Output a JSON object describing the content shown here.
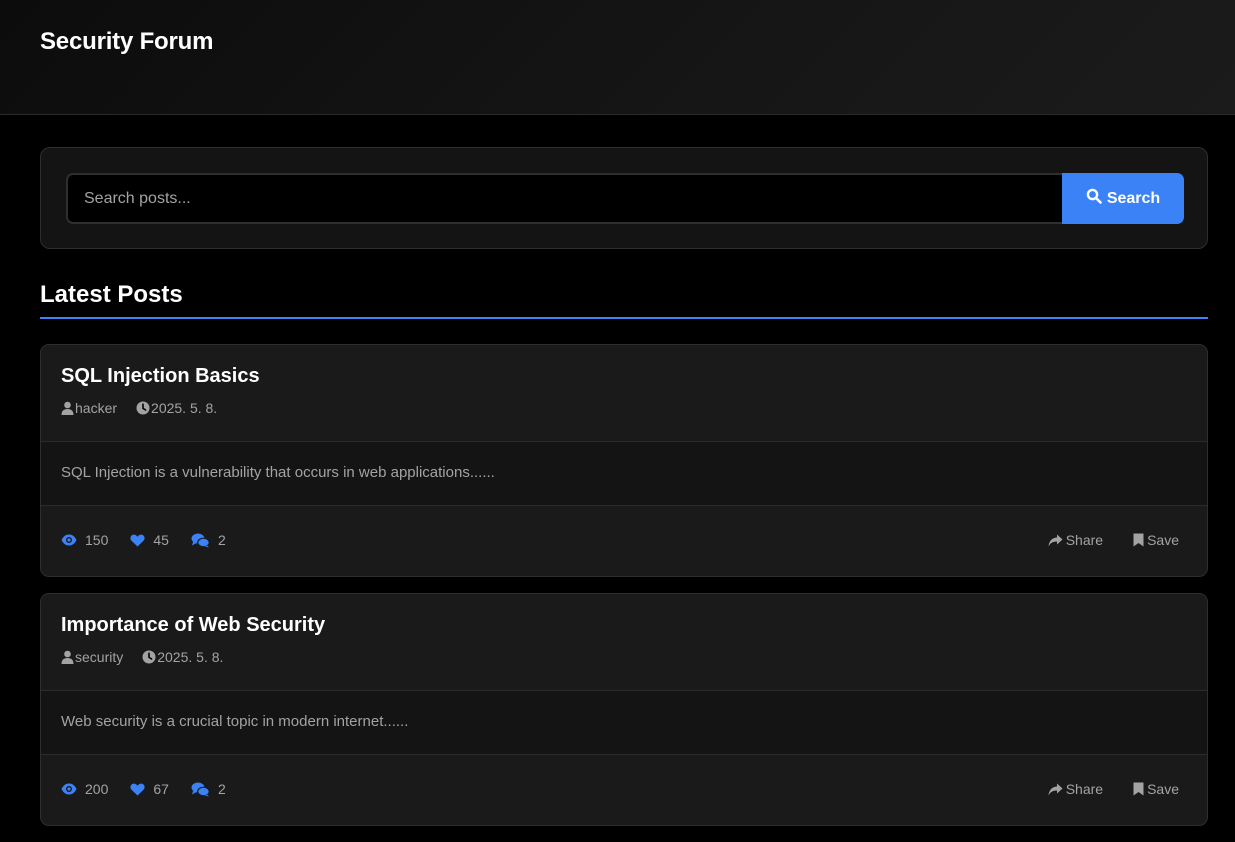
{
  "header": {
    "title": "Security Forum"
  },
  "search": {
    "placeholder": "Search posts...",
    "button_label": "Search"
  },
  "section": {
    "title": "Latest Posts"
  },
  "posts": [
    {
      "title": "SQL Injection Basics",
      "author": "hacker",
      "date": "2025. 5. 8.",
      "excerpt": "SQL Injection is a vulnerability that occurs in web applications......",
      "views": "150",
      "likes": "45",
      "comments": "2",
      "share_label": "Share",
      "save_label": "Save"
    },
    {
      "title": "Importance of Web Security",
      "author": "security",
      "date": "2025. 5. 8.",
      "excerpt": "Web security is a crucial topic in modern internet......",
      "views": "200",
      "likes": "67",
      "comments": "2",
      "share_label": "Share",
      "save_label": "Save"
    }
  ],
  "icons": {
    "search": "search-icon",
    "author": "user-icon",
    "date": "clock-icon",
    "views": "eye-icon",
    "likes": "heart-icon",
    "comments": "comments-icon",
    "share": "share-icon",
    "save": "bookmark-icon"
  },
  "colors": {
    "accent": "#3b82f6",
    "background": "#000000",
    "card": "#1a1a1a",
    "muted_text": "#a3a3a3"
  }
}
